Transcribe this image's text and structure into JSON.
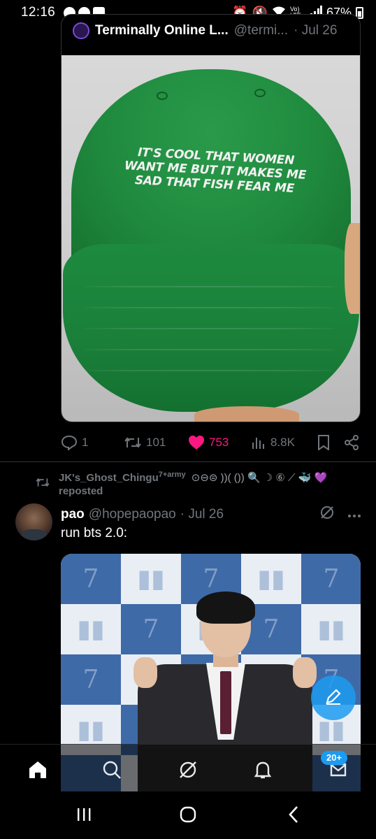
{
  "status_bar": {
    "time": "12:16",
    "battery": "67%",
    "signal_text": "Vo) LTE"
  },
  "quote_tweet": {
    "author_name": "Terminally Online L...",
    "handle": "@termi...",
    "date": "· Jul 26",
    "image_caption_lines": [
      "IT'S COOL THAT WOMEN",
      "WANT ME BUT IT MAKES ME",
      "SAD THAT FISH FEAR ME"
    ]
  },
  "actions": {
    "replies": "1",
    "reposts": "101",
    "likes": "753",
    "views": "8.8K"
  },
  "repost": {
    "user": "JK's_Ghost_Chingu",
    "superscript": "7+army",
    "emojis": "⊙⊖⊜ ))( ()) 🔍 ☽ ⑥ ⟋ 🐳",
    "heart": "💜",
    "label": "reposted"
  },
  "tweet": {
    "author_name": "pao",
    "handle": "@hopepaopao",
    "date": "· Jul 26",
    "text": "run bts 2.0:",
    "media_mark_7": "7",
    "media_mark_logo": "▮▮"
  },
  "bottom_nav": {
    "items": [
      "home-icon",
      "search-icon",
      "grok-icon",
      "notifications-icon",
      "messages-icon"
    ],
    "badge": "20+"
  },
  "colors": {
    "like": "#f91880",
    "accent": "#1d9bf0",
    "muted": "#71767b",
    "hat_green": "#1f8a3e"
  }
}
